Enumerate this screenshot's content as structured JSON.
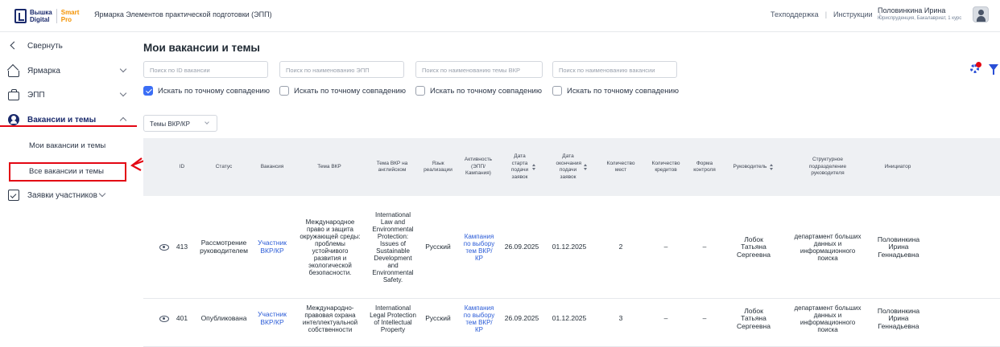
{
  "header": {
    "logo_line1": "Вышка",
    "logo_line2": "Digital",
    "logo_smart1": "Smart",
    "logo_smart2": "Pro",
    "app_title": "Ярмарка Элементов практической подготовки (ЭПП)",
    "links": [
      "Техподдержка",
      "Инструкции"
    ],
    "user_name": "Половинкина Ирина",
    "user_sub": "Юриспруденция, Бакалавриат, 1 курс"
  },
  "sidebar": {
    "items": [
      {
        "label": "Свернуть",
        "icon": "chevron-left-icon"
      },
      {
        "label": "Ярмарка",
        "icon": "home-icon"
      },
      {
        "label": "ЭПП",
        "icon": "briefcase-icon"
      },
      {
        "label": "Вакансии и темы",
        "icon": "vacancy-icon"
      },
      {
        "label": "Заявки участников",
        "icon": "clipboard-check-icon"
      }
    ],
    "sub_items": [
      "Мои вакансии и темы",
      "Все вакансии и темы"
    ]
  },
  "main": {
    "title": "Мои вакансии и темы",
    "search": [
      {
        "placeholder": "Поиск по ID вакансии"
      },
      {
        "placeholder": "Поиск по наименованию ЭПП"
      },
      {
        "placeholder": "Поиск по наименованию темы ВКР"
      },
      {
        "placeholder": "Поиск по наименованию вакансии"
      }
    ],
    "exact_match": [
      {
        "label": "Искать по точному совпадению",
        "checked": true
      },
      {
        "label": "Искать по точному совпадению",
        "checked": false
      },
      {
        "label": "Искать по точному совпадению",
        "checked": false
      },
      {
        "label": "Искать по точному совпадению",
        "checked": false
      }
    ],
    "type_select": "Темы ВКР/КР"
  },
  "table": {
    "headers": [
      "",
      "ID",
      "Статус",
      "Вакансия",
      "Тема ВКР",
      "Тема ВКР на английском",
      "Язык реализации",
      "Активность (ЭПП/ Кампания)",
      "Дата старта подачи заявок",
      "Дата окончания подачи заявок",
      "Количество мест",
      "Количество кредитов",
      "Форма контроля",
      "Руководитель",
      "Структурное подразделение руководителя",
      "Инициатор"
    ],
    "rows": [
      {
        "id": "413",
        "status": "Рассмотрение руководителем",
        "vacancy": "Участник ВКР/КР",
        "topic": "Международное право и защита окружающей среды: проблемы устойчивого развития и экологической безопасности.",
        "topic_en": "International Law and Environmental Protection: Issues of Sustainable Development and Environmental Safety.",
        "lang": "Русский",
        "activity": "Кампания по выбору тем ВКР/ КР",
        "start": "26.09.2025",
        "end": "01.12.2025",
        "places": "2",
        "credits": "–",
        "control": "–",
        "supervisor": "Лобок Татьяна Сергеевна",
        "department": "департамент больших данных и информационного поиска",
        "initiator": "Половинкина Ирина Геннадьевна"
      },
      {
        "id": "401",
        "status": "Опубликована",
        "vacancy": "Участник ВКР/КР",
        "topic": "Международно-правовая охрана интеллектуальной собственности",
        "topic_en": "International Legal Protection of Intellectual Property",
        "lang": "Русский",
        "activity": "Кампания по выбору тем ВКР/ КР",
        "start": "26.09.2025",
        "end": "01.12.2025",
        "places": "3",
        "credits": "–",
        "control": "–",
        "supervisor": "Лобок Татьяна Сергеевна",
        "department": "департамент больших данных и информационного поиска",
        "initiator": "Половинкина Ирина Геннадьевна"
      }
    ]
  },
  "colors": {
    "accent": "#1a2a6c",
    "link": "#2a5bd7",
    "highlight": "#e30613",
    "smart": "#f39200"
  }
}
